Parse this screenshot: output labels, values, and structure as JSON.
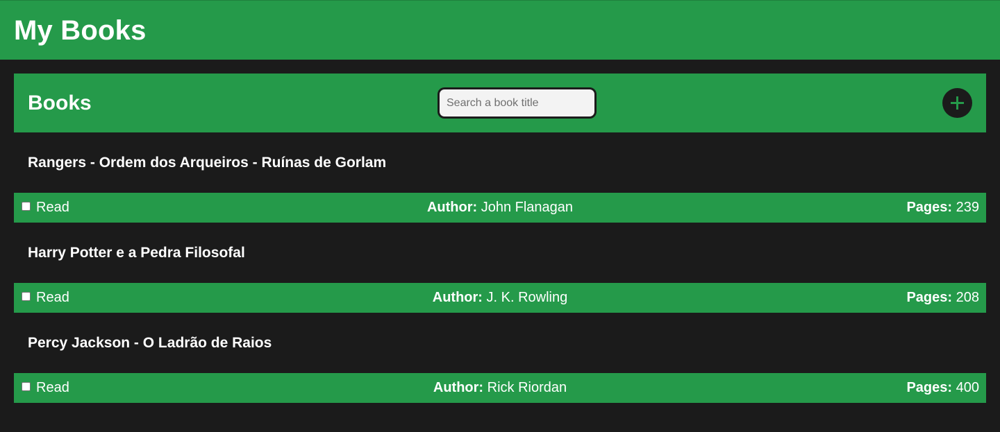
{
  "header": {
    "title": "My Books"
  },
  "toolbar": {
    "heading": "Books",
    "search_placeholder": "Search a book title",
    "search_value": "",
    "add_icon": "plus-icon"
  },
  "labels": {
    "read": "Read",
    "author": "Author:",
    "pages": "Pages:"
  },
  "books": [
    {
      "title": "Rangers - Ordem dos Arqueiros - Ruínas de Gorlam",
      "author": "John Flanagan",
      "pages": "239",
      "read": false
    },
    {
      "title": "Harry Potter e a Pedra Filosofal",
      "author": "J. K. Rowling",
      "pages": "208",
      "read": false
    },
    {
      "title": "Percy Jackson - O Ladrão de Raios",
      "author": "Rick Riordan",
      "pages": "400",
      "read": false
    }
  ],
  "colors": {
    "brand_green": "#259a4a",
    "background": "#1b1b1b",
    "text": "#ffffff"
  }
}
